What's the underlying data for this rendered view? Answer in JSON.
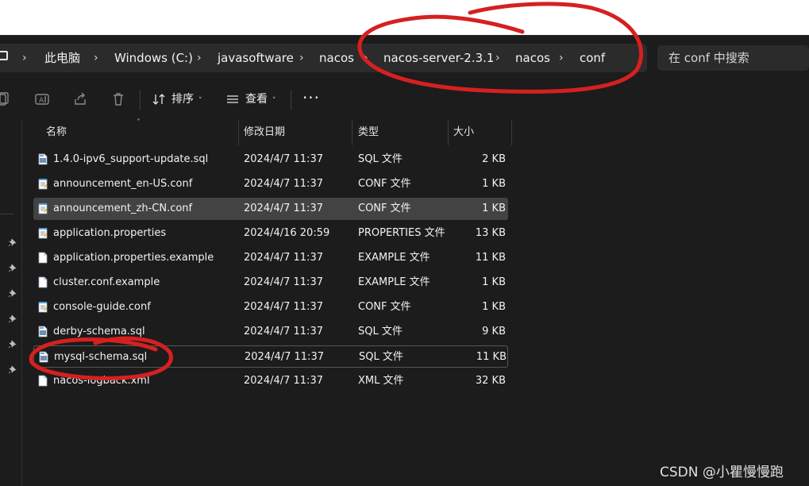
{
  "breadcrumb": {
    "items": [
      "此电脑",
      "Windows (C:)",
      "javasoftware",
      "nacos",
      "nacos-server-2.3.1",
      "nacos",
      "conf"
    ],
    "separator": "›"
  },
  "search": {
    "placeholder": "在 conf 中搜索"
  },
  "toolbar": {
    "sort_label": "排序",
    "view_label": "查看",
    "more_label": "···",
    "icons": [
      "copy-icon",
      "rename-icon",
      "share-icon",
      "delete-icon",
      "sort-icon",
      "view-icon"
    ]
  },
  "columns": {
    "name": "名称",
    "modified": "修改日期",
    "type": "类型",
    "size": "大小"
  },
  "files": [
    {
      "name": "1.4.0-ipv6_support-update.sql",
      "modified": "2024/4/7 11:37",
      "type": "SQL 文件",
      "size": "2 KB",
      "icon": "sql-file-icon"
    },
    {
      "name": "announcement_en-US.conf",
      "modified": "2024/4/7 11:37",
      "type": "CONF 文件",
      "size": "1 KB",
      "icon": "notepad-file-icon"
    },
    {
      "name": "announcement_zh-CN.conf",
      "modified": "2024/4/7 11:37",
      "type": "CONF 文件",
      "size": "1 KB",
      "icon": "notepad-file-icon",
      "selected": true
    },
    {
      "name": "application.properties",
      "modified": "2024/4/16 20:59",
      "type": "PROPERTIES 文件",
      "size": "13 KB",
      "icon": "notepad-file-icon"
    },
    {
      "name": "application.properties.example",
      "modified": "2024/4/7 11:37",
      "type": "EXAMPLE 文件",
      "size": "11 KB",
      "icon": "blank-file-icon"
    },
    {
      "name": "cluster.conf.example",
      "modified": "2024/4/7 11:37",
      "type": "EXAMPLE 文件",
      "size": "1 KB",
      "icon": "blank-file-icon"
    },
    {
      "name": "console-guide.conf",
      "modified": "2024/4/7 11:37",
      "type": "CONF 文件",
      "size": "1 KB",
      "icon": "notepad-file-icon"
    },
    {
      "name": "derby-schema.sql",
      "modified": "2024/4/7 11:37",
      "type": "SQL 文件",
      "size": "9 KB",
      "icon": "sql-file-icon"
    },
    {
      "name": "mysql-schema.sql",
      "modified": "2024/4/7 11:37",
      "type": "SQL 文件",
      "size": "11 KB",
      "icon": "sql-file-icon",
      "focused": true
    },
    {
      "name": "nacos-logback.xml",
      "modified": "2024/4/7 11:37",
      "type": "XML 文件",
      "size": "32 KB",
      "icon": "blank-file-icon"
    }
  ],
  "watermark": "CSDN @小瞿慢慢跑",
  "colors": {
    "window_bg": "#1c1c1c",
    "bar_bg": "#2b2b2b",
    "selected_row": "#434343",
    "annotation_red": "#d62020"
  }
}
